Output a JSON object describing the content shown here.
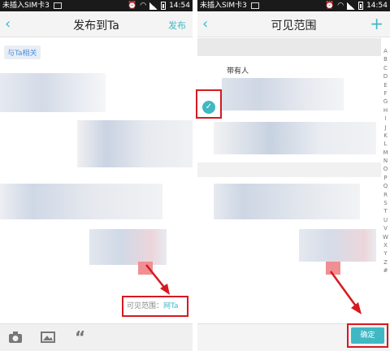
{
  "status_left": {
    "carrier": "未插入SIM卡3",
    "time": "14:54"
  },
  "status_right": {
    "carrier": "未插入SIM卡3",
    "time": "14:54"
  },
  "left": {
    "title": "发布到Ta",
    "action": "发布",
    "tag": "与Ta相关",
    "visible_range_label": "可见范围：",
    "visible_range_value": "网Ta"
  },
  "right": {
    "title": "可见范围",
    "row_label": "带有人",
    "alphabet": [
      "A",
      "B",
      "C",
      "D",
      "E",
      "F",
      "G",
      "H",
      "I",
      "J",
      "K",
      "L",
      "M",
      "N",
      "O",
      "P",
      "Q",
      "R",
      "S",
      "T",
      "U",
      "V",
      "W",
      "X",
      "Y",
      "Z",
      "#"
    ],
    "confirm": "确定"
  },
  "colors": {
    "accent": "#3fb8c4",
    "highlight": "#d71920"
  },
  "icons": {
    "back": "chevron-left-icon",
    "camera": "camera-icon",
    "image": "image-icon",
    "quote": "quote-icon",
    "add": "plus-icon",
    "check": "check-icon"
  }
}
